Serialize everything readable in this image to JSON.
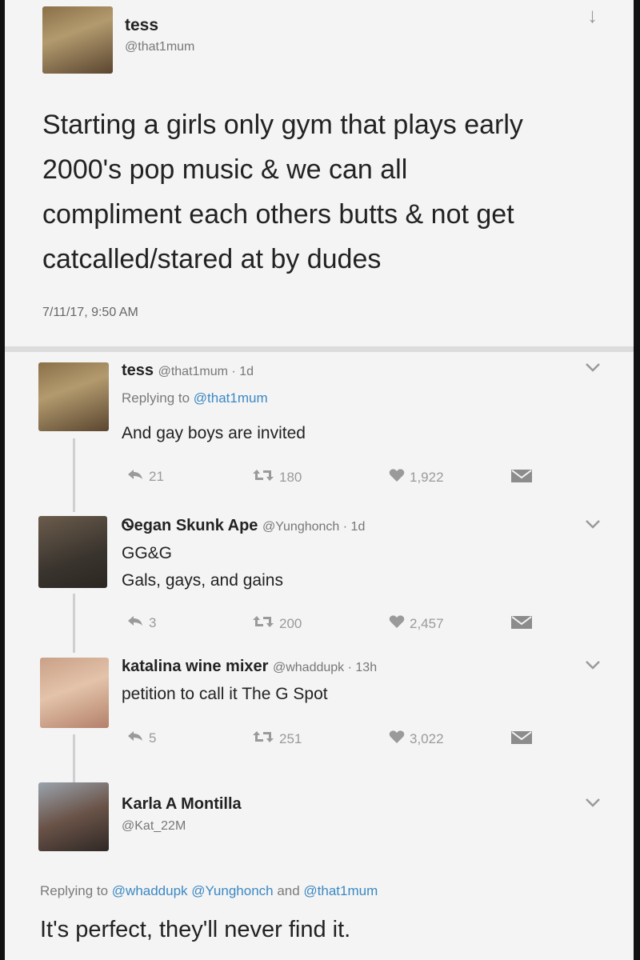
{
  "tweet": {
    "name": "tess",
    "handle": "@that1mum",
    "text_lines": [
      "Starting a girls only gym that plays early",
      "2000's pop music & we can all",
      "compliment each others butts & not get",
      "catcalled/stared at by dudes"
    ],
    "timestamp": "7/11/17, 9:50 AM",
    "follow_icon": "arrow-down-icon"
  },
  "replies": [
    {
      "name": "tess",
      "meta": "@that1mum · 1d",
      "replying_prefix": "Replying to ",
      "replying_handle": "@that1mum",
      "lines": [
        "And gay boys are invited"
      ],
      "reply_count": "21",
      "retweet_count": "180",
      "like_count": "1,922"
    },
    {
      "name": "Ꮻegan Skunk Ape",
      "meta": "@Yunghonch · 1d",
      "lines": [
        "GG&G",
        "Gals, gays, and gains"
      ],
      "reply_count": "3",
      "retweet_count": "200",
      "like_count": "2,457"
    },
    {
      "name": "katalina wine mixer",
      "meta": "@whaddupk · 13h",
      "lines": [
        "petition to call it The G Spot"
      ],
      "reply_count": "5",
      "retweet_count": "251",
      "like_count": "3,022"
    }
  ],
  "final": {
    "name": "Karla A Montilla",
    "handle": "@Kat_22M",
    "replying_prefix": "Replying to ",
    "replying_handles": "@whaddupk @Yunghonch",
    "replying_and": " and ",
    "replying_last": "@that1mum",
    "text": "It's perfect, they'll never find it."
  },
  "colors": {
    "link": "#3b88c3",
    "muted": "#9a9a9a",
    "text": "#222222"
  }
}
